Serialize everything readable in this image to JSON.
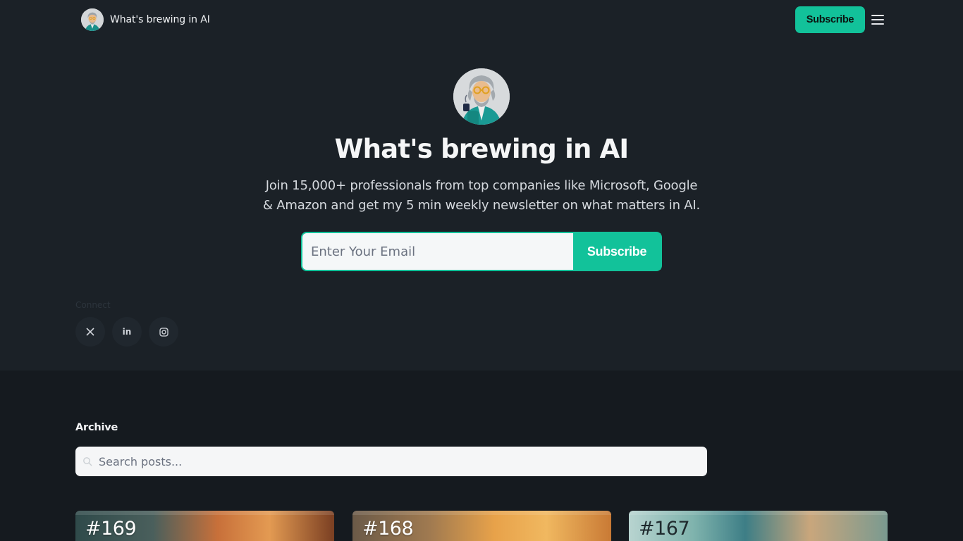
{
  "header": {
    "brand_name": "What's brewing in AI",
    "subscribe_label": "Subscribe"
  },
  "hero": {
    "title": "What's brewing in AI",
    "description": "Join 15,000+ professionals from top companies like Microsoft, Google & Amazon and get my 5 min weekly newsletter on what matters in AI.",
    "email_placeholder": "Enter Your Email",
    "subscribe_label": "Subscribe"
  },
  "connect": {
    "label": "Connect",
    "links": [
      {
        "icon": "x-icon",
        "glyph": "𝕏"
      },
      {
        "icon": "linkedin-icon",
        "glyph": "in"
      },
      {
        "icon": "instagram-icon",
        "glyph": ""
      }
    ]
  },
  "archive": {
    "title": "Archive",
    "search_placeholder": "Search posts...",
    "posts": [
      {
        "number": "#169"
      },
      {
        "number": "#168"
      },
      {
        "number": "#167"
      }
    ]
  },
  "colors": {
    "accent": "#12c29a",
    "page_bg": "#1b2127",
    "archive_bg": "#151a1f"
  }
}
